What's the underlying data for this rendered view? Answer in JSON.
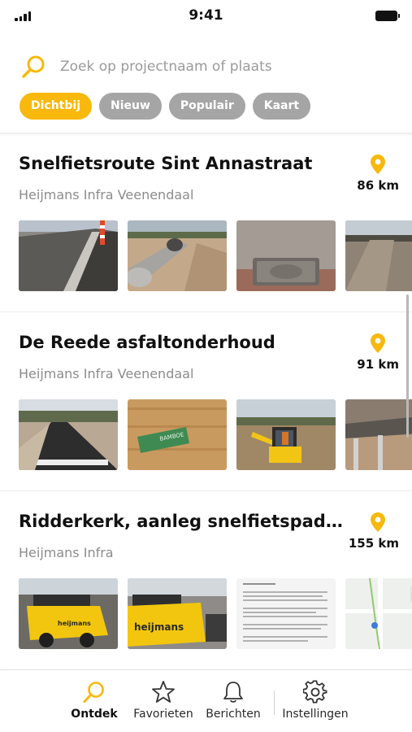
{
  "status_bar": {
    "time": "9:41"
  },
  "search": {
    "placeholder": "Zoek op projectnaam of plaats",
    "value": ""
  },
  "filters": [
    {
      "label": "Dichtbij",
      "active": true
    },
    {
      "label": "Nieuw",
      "active": false
    },
    {
      "label": "Populair",
      "active": false
    },
    {
      "label": "Kaart",
      "active": false
    }
  ],
  "projects": [
    {
      "title": "Snelfietsroute Sint Annastraat",
      "subtitle": "Heijmans Infra Veenendaal",
      "distance": "86 km",
      "photos": [
        "road-curb-construction-photo",
        "concrete-pipes-sand-photo",
        "paving-manhole-photo",
        "road-works-photo"
      ]
    },
    {
      "title": "De Reede asfaltonderhoud",
      "subtitle": "Heijmans Infra Veenendaal",
      "distance": "91 km",
      "photos": [
        "new-asphalt-cycle-path-photo",
        "bamboo-board-photo",
        "mini-excavator-photo",
        "steel-structure-photo"
      ]
    },
    {
      "title": "Ridderkerk, aanleg snelfietspad Ring...",
      "subtitle": "Heijmans Infra",
      "distance": "155 km",
      "photos": [
        "heijmans-asphalt-paver-photo",
        "heijmans-paver-closeup-photo",
        "document-page-photo",
        "map-screenshot-photo"
      ]
    }
  ],
  "photo_text": {
    "bamboo_label": "BAMBOE",
    "heijmans_label": "heijmans"
  },
  "tabs": [
    {
      "label": "Ontdek",
      "icon": "search-icon",
      "active": true
    },
    {
      "label": "Favorieten",
      "icon": "star-icon",
      "active": false
    },
    {
      "label": "Berichten",
      "icon": "bell-icon",
      "active": false
    },
    {
      "label": "Instellingen",
      "icon": "gear-icon",
      "active": false
    }
  ],
  "colors": {
    "accent": "#f8b80c",
    "chip_inactive": "#a5a5a5",
    "subtitle": "#8c8c8c"
  }
}
